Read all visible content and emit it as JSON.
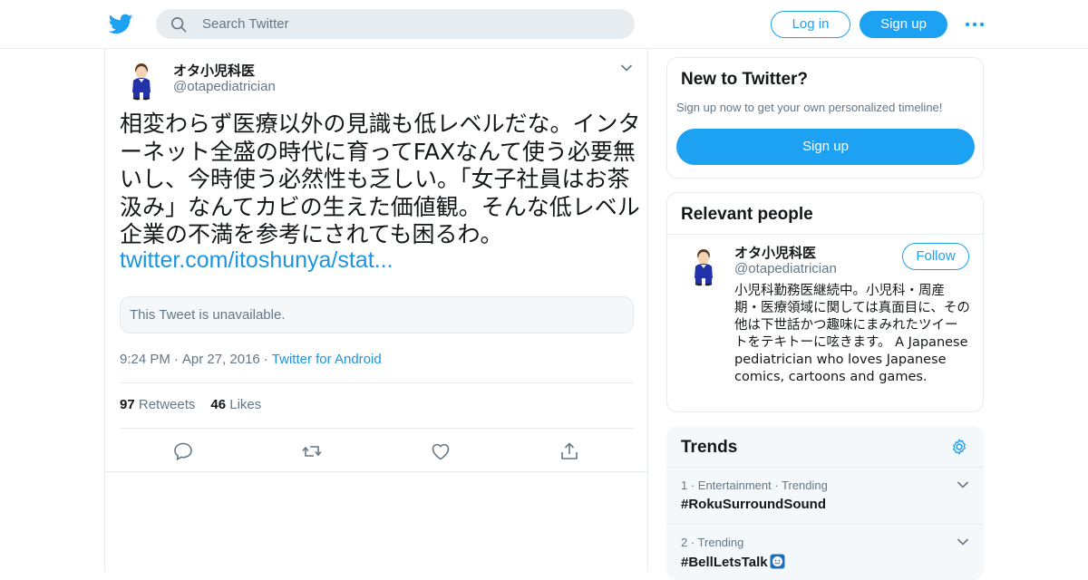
{
  "header": {
    "search_placeholder": "Search Twitter",
    "login_label": "Log in",
    "signup_label": "Sign up"
  },
  "tweet": {
    "author_name": "オタ小児科医",
    "author_handle": "@otapediatrician",
    "text": "相変わらず医療以外の見識も低レベルだな。インターネット全盛の時代に育ってFAXなんて使う必要無いし、今時使う必然性も乏しい。「女子社員はお茶汲み」なんてカビの生えた価値観。そんな低レベル企業の不満を参考にされても困るわ。",
    "link": "twitter.com/itoshunya/stat...",
    "quoted_unavailable": "This Tweet is unavailable.",
    "time": "9:24 PM",
    "date": "Apr 27, 2016",
    "source": "Twitter for Android",
    "dot": "·",
    "retweets_count": "97",
    "retweets_label": "Retweets",
    "likes_count": "46",
    "likes_label": "Likes"
  },
  "sidebar": {
    "new_title": "New to Twitter?",
    "new_subtitle": "Sign up now to get your own personalized timeline!",
    "new_button": "Sign up",
    "relevant_title": "Relevant people",
    "person_name": "オタ小児科医",
    "person_handle": "@otapediatrician",
    "follow_label": "Follow",
    "person_bio": "小児科勤務医継続中。小児科・周産期・医療領域に関しては真面目に、その他は下世話かつ趣味にまみれたツイートをテキトーに呟きます。 A Japanese pediatrician who loves Japanese comics, cartoons and games.",
    "trends_title": "Trends",
    "trends": [
      {
        "meta": "1 · Entertainment · Trending",
        "tag": "#RokuSurroundSound"
      },
      {
        "meta": "2 · Trending",
        "tag": "#BellLetsTalk"
      }
    ]
  },
  "colors": {
    "accent": "#1da1f2",
    "link": "#1b95e0",
    "muted": "#657786",
    "border": "#e6ecf0"
  }
}
